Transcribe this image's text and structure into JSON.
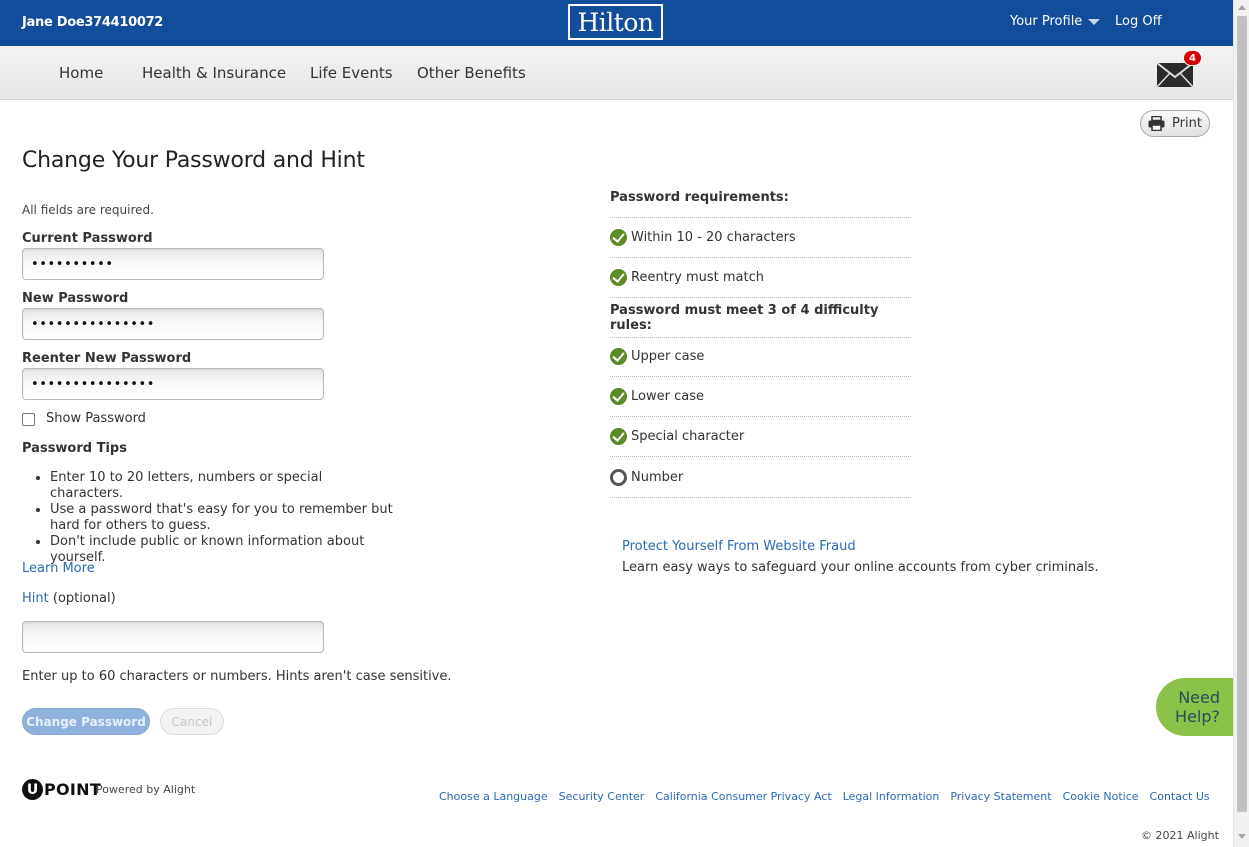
{
  "header": {
    "user_name": "Jane Doe374410072",
    "logo_text": "Hilton",
    "profile_label": "Your Profile",
    "logoff_label": "Log Off"
  },
  "nav": {
    "items": [
      "Home",
      "Health & Insurance",
      "Life Events",
      "Other Benefits"
    ],
    "mail_badge": "4"
  },
  "toolbar": {
    "print_label": "Print"
  },
  "page": {
    "title": "Change Your Password and Hint",
    "required_note": "All fields are required."
  },
  "form": {
    "current_password_label": "Current Password",
    "current_password_value": "••••••••••",
    "new_password_label": "New Password",
    "new_password_value": "•••••••••••••••",
    "reenter_password_label": "Reenter New Password",
    "reenter_password_value": "•••••••••••••••",
    "show_password_label": "Show Password",
    "tips_title": "Password Tips",
    "tips": [
      "Enter 10 to 20 letters, numbers or special characters.",
      "Use a password that's easy for you to remember but hard for others to guess.",
      "Don't include public or known information about yourself."
    ],
    "learn_more": "Learn More",
    "hint_label": "Hint",
    "hint_optional": "(optional)",
    "hint_value": "",
    "hint_note": "Enter up to 60 characters or numbers. Hints aren't case sensitive.",
    "submit_label": "Change Password",
    "cancel_label": "Cancel"
  },
  "requirements": {
    "title": "Password requirements:",
    "basic": [
      {
        "label": "Within 10 - 20 characters",
        "met": true
      },
      {
        "label": "Reentry must match",
        "met": true
      }
    ],
    "difficulty_title": "Password must meet 3 of 4 difficulty rules:",
    "difficulty": [
      {
        "label": "Upper case",
        "met": true
      },
      {
        "label": "Lower case",
        "met": true
      },
      {
        "label": "Special character",
        "met": true
      },
      {
        "label": "Number",
        "met": false
      }
    ]
  },
  "fraud": {
    "link": "Protect Yourself From Website Fraud",
    "text": "Learn easy ways to safeguard your online accounts from cyber criminals."
  },
  "help": {
    "label_line1": "Need",
    "label_line2": "Help?"
  },
  "footer": {
    "brand_u": "U",
    "brand_point": "POINT",
    "powered_by": "Powered by Alight",
    "links": [
      "Choose a Language",
      "Security Center",
      "California Consumer Privacy Act",
      "Legal Information",
      "Privacy Statement",
      "Cookie Notice",
      "Contact Us"
    ],
    "copyright": "© 2021 Alight"
  },
  "colors": {
    "header_bg": "#124d9b",
    "link": "#2a6ab5",
    "check_green": "#5a8b24",
    "help_green": "#8bc34a",
    "badge_red": "#d50000"
  }
}
